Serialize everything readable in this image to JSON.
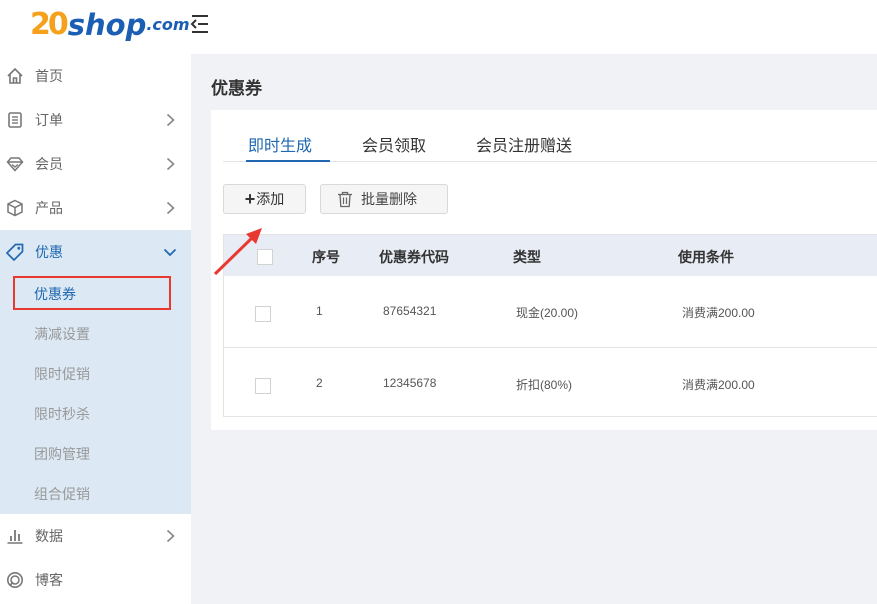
{
  "logo": {
    "part1": "20",
    "part2": "shop",
    "part3": ".com"
  },
  "sidebar": {
    "items": [
      {
        "label": "首页",
        "icon": "home-icon"
      },
      {
        "label": "订单",
        "icon": "order-icon"
      },
      {
        "label": "会员",
        "icon": "member-icon"
      },
      {
        "label": "产品",
        "icon": "product-icon"
      },
      {
        "label": "优惠",
        "icon": "promo-tag-icon"
      },
      {
        "label": "数据",
        "icon": "chart-icon"
      },
      {
        "label": "博客",
        "icon": "blog-icon"
      }
    ],
    "promo_sub": [
      "优惠券",
      "满减设置",
      "限时促销",
      "限时秒杀",
      "团购管理",
      "组合促销"
    ]
  },
  "page": {
    "title": "优惠券",
    "tabs": [
      "即时生成",
      "会员领取",
      "会员注册赠送"
    ],
    "add_button": "添加",
    "add_plus": "+",
    "delete_button": "批量删除"
  },
  "table": {
    "headers": [
      "序号",
      "优惠券代码",
      "类型",
      "使用条件"
    ],
    "rows": [
      {
        "no": "1",
        "code": "87654321",
        "type": "现金(20.00)",
        "condition": "消费满200.00"
      },
      {
        "no": "2",
        "code": "12345678",
        "type": "折扣(80%)",
        "condition": "消费满200.00"
      }
    ]
  },
  "colors": {
    "primary": "#2068b0",
    "highlight": "#e8382f",
    "logo_orange": "#f5a11b",
    "logo_blue": "#1a5fb4"
  }
}
